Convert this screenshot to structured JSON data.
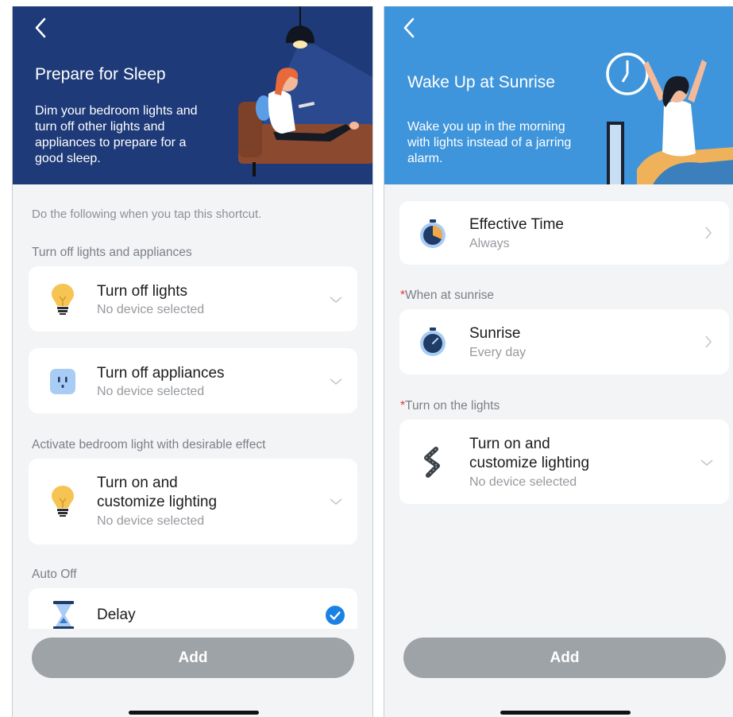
{
  "left": {
    "title": "Prepare for Sleep",
    "description": [
      "Dim your bedroom lights and",
      "turn off other lights and",
      "appliances to prepare for a",
      "good sleep."
    ],
    "hint": "Do the following when you tap this shortcut.",
    "section1": "Turn off lights and appliances",
    "card_lights": {
      "title": "Turn off lights",
      "subtitle": "No device selected"
    },
    "card_appliances": {
      "title": "Turn off appliances",
      "subtitle": "No device selected"
    },
    "section2": "Activate bedroom light with desirable effect",
    "card_customize": {
      "title_line1": "Turn on and",
      "title_line2": "customize lighting",
      "subtitle": "No device selected"
    },
    "section3": "Auto Off",
    "card_delay": {
      "title": "Delay",
      "checked": true
    },
    "add_label": "Add"
  },
  "right": {
    "title": "Wake Up at Sunrise",
    "description": [
      "Wake you up in the morning",
      "with lights instead of a jarring",
      "alarm."
    ],
    "card_time": {
      "title": "Effective Time",
      "subtitle": "Always"
    },
    "section1_mark": "*",
    "section1": "When at sunrise",
    "card_sunrise": {
      "title": "Sunrise",
      "subtitle": "Every day"
    },
    "section2_mark": "*",
    "section2": "Turn on the lights",
    "card_lighting": {
      "title_line1": "Turn on and",
      "title_line2": "customize lighting",
      "subtitle": "No device selected"
    },
    "add_label": "Add"
  },
  "icons": {
    "back": "chevron-left-icon",
    "bulb": "light-bulb-icon",
    "socket": "power-socket-icon",
    "hourglass": "hourglass-icon",
    "check": "checkmark-circle-icon",
    "timer": "timer-icon",
    "strip": "light-strip-icon",
    "chevron_down": "chevron-down-icon",
    "chevron_right": "chevron-right-icon"
  },
  "colors": {
    "left_hero": "#1e3a78",
    "right_hero": "#3f95db",
    "button_disabled": "#9ea3a8",
    "check_blue": "#1a82e2",
    "required_red": "#e53935"
  }
}
